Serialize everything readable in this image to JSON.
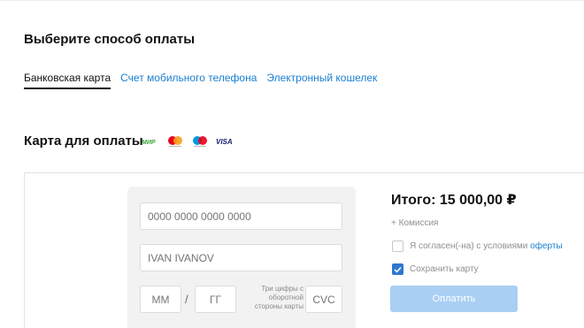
{
  "page": {
    "title": "Выберите способ оплаты"
  },
  "tabs": [
    {
      "label": "Банковская карта",
      "active": true
    },
    {
      "label": "Счет мобильного телефона",
      "active": false
    },
    {
      "label": "Электронный кошелек",
      "active": false
    }
  ],
  "card_section": {
    "title": "Карта для оплаты",
    "brands": [
      {
        "name": "mir",
        "text": "МИР",
        "color": "#3aa53a"
      },
      {
        "name": "mastercard",
        "colors": [
          "#eb001b",
          "#f79e1b"
        ]
      },
      {
        "name": "maestro",
        "colors": [
          "#0099df",
          "#eb001b"
        ]
      },
      {
        "name": "visa",
        "text": "VISA",
        "color": "#1a1f71"
      }
    ]
  },
  "form": {
    "card_number_placeholder": "0000 0000 0000 0000",
    "holder_placeholder": "IVAN IVANOV",
    "month_placeholder": "ММ",
    "year_placeholder": "ГГ",
    "slash": "/",
    "cvc_hint": "Три цифры с оборотной стороны карты",
    "cvc_placeholder": "CVC"
  },
  "summary": {
    "total": "Итого: 15 000,00 ₽",
    "commission": "+ Комиссия",
    "agree_text": "Я согласен(-на) с условиями ",
    "agree_link": "оферты",
    "agree_checked": false,
    "save_card_text": "Сохранить карту",
    "save_card_checked": true,
    "pay_button": "Оплатить"
  },
  "colors": {
    "accent": "#1a7fd1",
    "checkbox_checked": "#2e77d0",
    "button_disabled": "#a9cff3",
    "form_background": "#f2f2f2"
  }
}
